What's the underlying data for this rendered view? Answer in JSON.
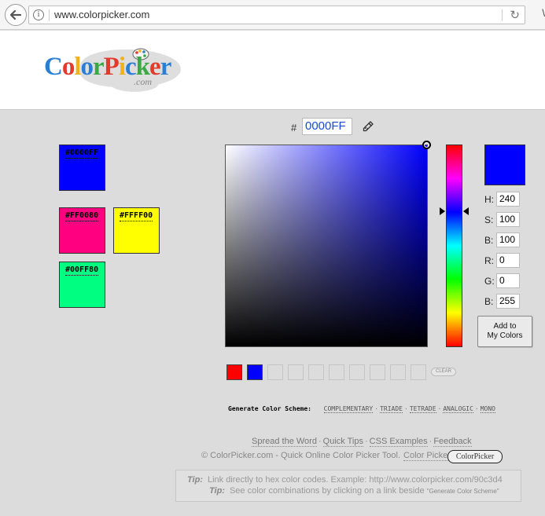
{
  "browser": {
    "url": "www.colorpicker.com",
    "menu_fragment": "\\"
  },
  "logo": {
    "letters": [
      {
        "ch": "C",
        "color": "#2a7fd4"
      },
      {
        "ch": "o",
        "color": "#e23b2e"
      },
      {
        "ch": "l",
        "color": "#f0b21c"
      },
      {
        "ch": "o",
        "color": "#2a7fd4"
      },
      {
        "ch": "r",
        "color": "#3aa845"
      },
      {
        "ch": "P",
        "color": "#e23b2e"
      },
      {
        "ch": "i",
        "color": "#f0b21c"
      },
      {
        "ch": "c",
        "color": "#2a7fd4"
      },
      {
        "ch": "k",
        "color": "#3aa845"
      },
      {
        "ch": "e",
        "color": "#e23b2e"
      },
      {
        "ch": "r",
        "color": "#2a7fd4"
      }
    ],
    "suffix": ".com"
  },
  "saved_colors": [
    {
      "label": "#0000FF",
      "color": "#0000FF"
    },
    {
      "label": "#FF0080",
      "color": "#FF0080"
    },
    {
      "label": "#FFFF00",
      "color": "#FFFF00"
    },
    {
      "label": "#00FF80",
      "color": "#00FF80"
    }
  ],
  "picker": {
    "hash": "#",
    "hex_value": "0000FF",
    "hue_color": "#0000FF",
    "preview_color": "#0000FF",
    "fields": [
      {
        "label": "H:",
        "value": "240"
      },
      {
        "label": "S:",
        "value": "100"
      },
      {
        "label": "B:",
        "value": "100"
      },
      {
        "label": "R:",
        "value": "0"
      },
      {
        "label": "G:",
        "value": "0"
      },
      {
        "label": "B:",
        "value": "255"
      }
    ],
    "add_button": {
      "line1": "Add to",
      "line2": "My Colors"
    }
  },
  "recent_colors": {
    "slots": [
      "#FF0000",
      "#0000FF",
      "",
      "",
      "",
      "",
      "",
      "",
      "",
      ""
    ],
    "clear_label": "CLEAR"
  },
  "scheme": {
    "label": "Generate Color Scheme:",
    "links": [
      "COMPLEMENTARY",
      "TRIADE",
      "TETRADE",
      "ANALOGIC",
      "MONO"
    ]
  },
  "footer": {
    "links": [
      "Spread the Word",
      "Quick Tips",
      "CSS Examples",
      "Feedback"
    ],
    "copyright": "© ColorPicker.com - Quick Online Color Picker Tool.",
    "copyright_link": "Color Picker",
    "badge": "ColorPicker"
  },
  "tips": [
    {
      "key": "Tip:",
      "text": "Link directly to hex color codes.   Example: http://www.colorpicker.com/90c3d4",
      "small": ""
    },
    {
      "key": "Tip:",
      "text": "See color combinations by clicking on a link beside",
      "small": "\"Generate Color Scheme\""
    }
  ]
}
